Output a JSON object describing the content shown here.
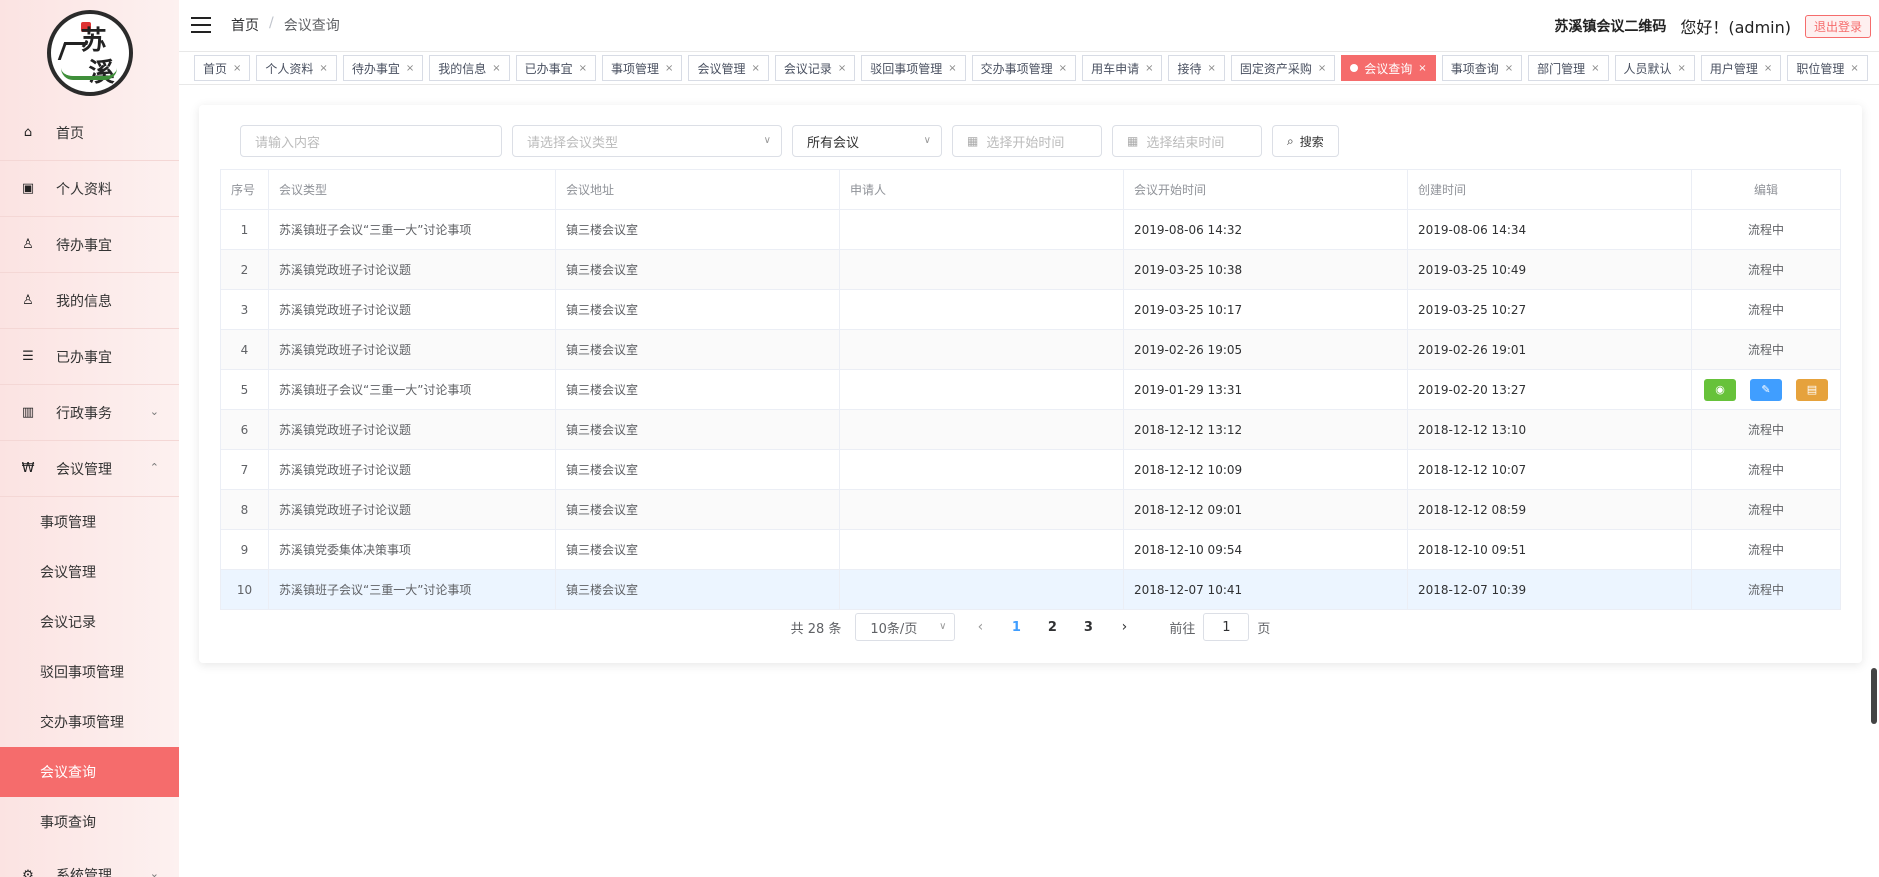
{
  "sidebar": {
    "logo_text": [
      "苏",
      "溪"
    ],
    "menu": [
      {
        "label": "首页",
        "icon": "home-icon"
      },
      {
        "label": "个人资料",
        "icon": "profile-icon"
      },
      {
        "label": "待办事宜",
        "icon": "user-clock-icon"
      },
      {
        "label": "我的信息",
        "icon": "user-info-icon"
      },
      {
        "label": "已办事宜",
        "icon": "document-done-icon"
      },
      {
        "label": "行政事务",
        "icon": "building-icon",
        "chevron": "⌄"
      },
      {
        "label": "会议管理",
        "icon": "meeting-icon",
        "chevron": "⌃"
      }
    ],
    "submenu": [
      {
        "label": "事项管理"
      },
      {
        "label": "会议管理"
      },
      {
        "label": "会议记录"
      },
      {
        "label": "驳回事项管理"
      },
      {
        "label": "交办事项管理"
      },
      {
        "label": "会议查询",
        "active": true
      },
      {
        "label": "事项查询"
      }
    ],
    "bottom_menu": {
      "label": "系统管理",
      "icon": "system-settings-icon",
      "chevron": "⌄"
    }
  },
  "header": {
    "breadcrumb_home": "首页",
    "breadcrumb_sep": "/",
    "breadcrumb_current": "会议查询",
    "qr_link": "苏溪镇会议二维码",
    "greeting": "您好！(admin)",
    "logout": "退出登录"
  },
  "tags": [
    {
      "label": "首页"
    },
    {
      "label": "个人资料"
    },
    {
      "label": "待办事宜"
    },
    {
      "label": "我的信息"
    },
    {
      "label": "已办事宜"
    },
    {
      "label": "事项管理"
    },
    {
      "label": "会议管理"
    },
    {
      "label": "会议记录"
    },
    {
      "label": "驳回事项管理"
    },
    {
      "label": "交办事项管理"
    },
    {
      "label": "用车申请"
    },
    {
      "label": "接待"
    },
    {
      "label": "固定资产采购"
    },
    {
      "label": "会议查询",
      "active": true
    },
    {
      "label": "事项查询"
    },
    {
      "label": "部门管理"
    },
    {
      "label": "人员默认"
    },
    {
      "label": "用户管理"
    },
    {
      "label": "职位管理"
    }
  ],
  "filters": {
    "keyword_placeholder": "请输入内容",
    "type_placeholder": "请选择会议类型",
    "scope_value": "所有会议",
    "start_placeholder": "选择开始时间",
    "end_placeholder": "选择结束时间",
    "search_label": "搜索"
  },
  "table": {
    "headers": [
      "序号",
      "会议类型",
      "会议地址",
      "申请人",
      "会议开始时间",
      "创建时间",
      "编辑"
    ],
    "rows": [
      {
        "no": "1",
        "type": "苏溪镇班子会议“三重一大”讨论事项",
        "addr": "镇三楼会议室",
        "applicant": "",
        "start": "2019-08-06 14:32",
        "created": "2019-08-06 14:34",
        "status": "流程中"
      },
      {
        "no": "2",
        "type": "苏溪镇党政班子讨论议题",
        "addr": "镇三楼会议室",
        "applicant": "",
        "start": "2019-03-25 10:38",
        "created": "2019-03-25 10:49",
        "status": "流程中"
      },
      {
        "no": "3",
        "type": "苏溪镇党政班子讨论议题",
        "addr": "镇三楼会议室",
        "applicant": "",
        "start": "2019-03-25 10:17",
        "created": "2019-03-25 10:27",
        "status": "流程中"
      },
      {
        "no": "4",
        "type": "苏溪镇党政班子讨论议题",
        "addr": "镇三楼会议室",
        "applicant": "",
        "start": "2019-02-26 19:05",
        "created": "2019-02-26 19:01",
        "status": "流程中"
      },
      {
        "no": "5",
        "type": "苏溪镇班子会议“三重一大”讨论事项",
        "addr": "镇三楼会议室",
        "applicant": "",
        "start": "2019-01-29 13:31",
        "created": "2019-02-20 13:27",
        "status": "",
        "actions": true
      },
      {
        "no": "6",
        "type": "苏溪镇党政班子讨论议题",
        "addr": "镇三楼会议室",
        "applicant": "",
        "start": "2018-12-12 13:12",
        "created": "2018-12-12 13:10",
        "status": "流程中"
      },
      {
        "no": "7",
        "type": "苏溪镇党政班子讨论议题",
        "addr": "镇三楼会议室",
        "applicant": "",
        "start": "2018-12-12 10:09",
        "created": "2018-12-12 10:07",
        "status": "流程中"
      },
      {
        "no": "8",
        "type": "苏溪镇党政班子讨论议题",
        "addr": "镇三楼会议室",
        "applicant": "",
        "start": "2018-12-12 09:01",
        "created": "2018-12-12 08:59",
        "status": "流程中"
      },
      {
        "no": "9",
        "type": "苏溪镇党委集体决策事项",
        "addr": "镇三楼会议室",
        "applicant": "",
        "start": "2018-12-10 09:54",
        "created": "2018-12-10 09:51",
        "status": "流程中"
      },
      {
        "no": "10",
        "type": "苏溪镇班子会议“三重一大”讨论事项",
        "addr": "镇三楼会议室",
        "applicant": "",
        "start": "2018-12-07 10:41",
        "created": "2018-12-07 10:39",
        "status": "流程中"
      }
    ]
  },
  "pagination": {
    "total": "共 28 条",
    "page_size": "10条/页",
    "pages": [
      "1",
      "2",
      "3"
    ],
    "current": "1",
    "goto_prefix": "前往",
    "goto_value": "1",
    "goto_suffix": "页"
  }
}
